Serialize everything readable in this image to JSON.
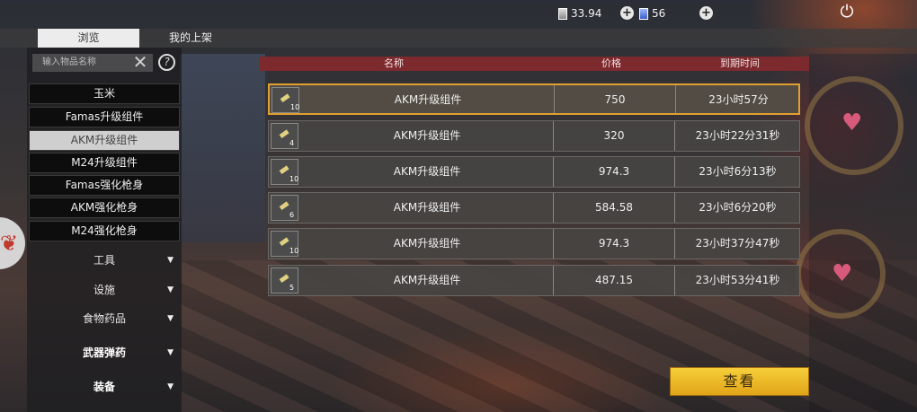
{
  "top": {
    "silver_amount": "33.94",
    "blue_amount": "56",
    "silver_icon": "silver-gem-icon",
    "blue_icon": "blue-gem-icon",
    "power_icon": "power-icon"
  },
  "tabs": [
    {
      "label": "浏览",
      "active": true
    },
    {
      "label": "我的上架",
      "active": false
    }
  ],
  "search": {
    "placeholder": "输入物品名称"
  },
  "sidebar": {
    "sub_items": [
      "玉米",
      "Famas升级组件",
      "AKM升级组件",
      "M24升级组件",
      "Famas强化枪身",
      "AKM强化枪身",
      "M24强化枪身"
    ],
    "selected_index": 2,
    "categories": [
      "工具",
      "设施",
      "食物药品",
      "武器弹药",
      "装备"
    ]
  },
  "table": {
    "headers": {
      "name": "名称",
      "price": "价格",
      "expire": "到期时间"
    },
    "rows": [
      {
        "name": "AKM升级组件",
        "price": "750",
        "expire": "23小时57分",
        "qty": "10",
        "selected": true
      },
      {
        "name": "AKM升级组件",
        "price": "320",
        "expire": "23小时22分31秒",
        "qty": "4",
        "selected": false
      },
      {
        "name": "AKM升级组件",
        "price": "974.3",
        "expire": "23小时6分13秒",
        "qty": "10",
        "selected": false
      },
      {
        "name": "AKM升级组件",
        "price": "584.58",
        "expire": "23小时6分20秒",
        "qty": "6",
        "selected": false
      },
      {
        "name": "AKM升级组件",
        "price": "974.3",
        "expire": "23小时37分47秒",
        "qty": "10",
        "selected": false
      },
      {
        "name": "AKM升级组件",
        "price": "487.15",
        "expire": "23小时53分41秒",
        "qty": "5",
        "selected": false
      }
    ]
  },
  "view_button": "查看",
  "colors": {
    "accent": "#e0a030",
    "header": "#7d2a2e",
    "button": "#f0c030"
  }
}
